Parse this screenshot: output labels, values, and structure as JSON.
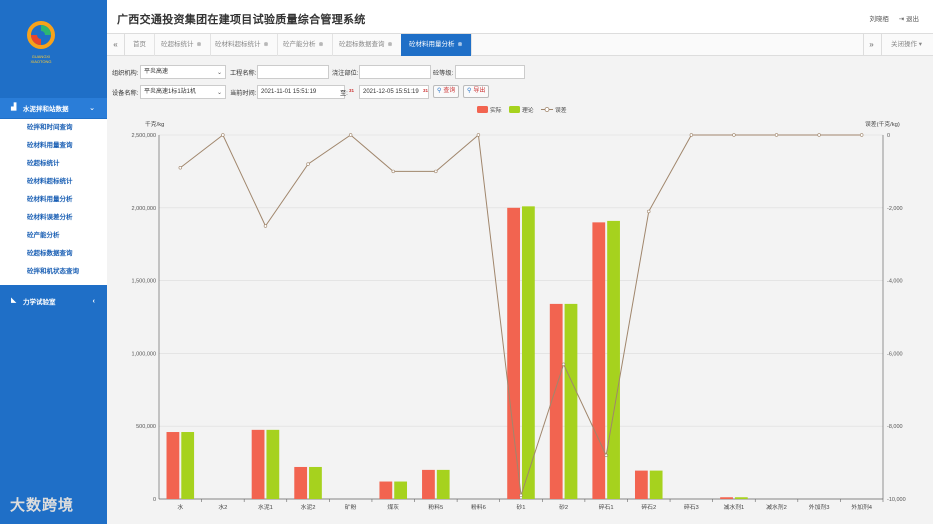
{
  "app": {
    "title": "广西交通投资集团在建项目试验质量综合管理系统",
    "user": "刘晓栢",
    "logout": "退出",
    "logo_text": "GUANGXI XIAOTONG"
  },
  "sidebar": {
    "groups": [
      {
        "label": "水泥拌和站数据",
        "icon": "bar-chart-icon",
        "arrow": "⌄"
      },
      {
        "label": "力学试验室",
        "icon": "rss-icon",
        "arrow": "‹"
      }
    ],
    "items": [
      {
        "label": "砼拌和时间查询"
      },
      {
        "label": "砼材料用量查询"
      },
      {
        "label": "砼超标统计"
      },
      {
        "label": "砼材料超标统计"
      },
      {
        "label": "砼材料用量分析"
      },
      {
        "label": "砼材料误差分析"
      },
      {
        "label": "砼产能分析"
      },
      {
        "label": "砼超标数据查询"
      },
      {
        "label": "砼拌和机状态查询"
      }
    ]
  },
  "tabs": {
    "items": [
      {
        "label": "首页",
        "closable": false
      },
      {
        "label": "砼超标统计",
        "closable": true
      },
      {
        "label": "砼材料超标统计",
        "closable": true
      },
      {
        "label": "砼产能分析",
        "closable": true
      },
      {
        "label": "砼超标数据查询",
        "closable": true
      },
      {
        "label": "砼材料用量分析",
        "closable": true,
        "active": true
      }
    ],
    "close_ops": "关闭操作"
  },
  "filters": {
    "org_label": "组织机构:",
    "org_value": "平炎高速",
    "project_label": "工程名称:",
    "project_value": "",
    "pour_label": "浇注部位:",
    "pour_value": "",
    "grade_label": "砼等级:",
    "grade_value": "",
    "device_label": "设备名称:",
    "device_value": "平炎高速1标1站1机",
    "start_label": "当前时间:",
    "start_value": "2021-11-01 15:51:19",
    "end_label": "至:",
    "end_value": "2021-12-05 15:51:19",
    "cal_label": "31",
    "query_btn": "查询",
    "export_btn": "导出"
  },
  "colors": {
    "actual": "#f26450",
    "theory": "#a6d21e",
    "error": "#a0866c",
    "brand": "#1f6fc7"
  },
  "chart_data": {
    "type": "bar",
    "ylabel": "千克/kg",
    "y2label": "误差(千克/kg)",
    "ylim": [
      0,
      2500000
    ],
    "y2lim": [
      -10000,
      0
    ],
    "yticks": [
      "0",
      "500,000",
      "1,000,000",
      "1,500,000",
      "2,000,000",
      "2,500,000"
    ],
    "y2ticks": [
      "-10,000",
      "-8,000",
      "-6,000",
      "-4,000",
      "-2,000",
      "0"
    ],
    "grid": true,
    "legend": "top-center",
    "categories": [
      "水",
      "水2",
      "水泥1",
      "水泥2",
      "矿粉",
      "煤灰",
      "粉料5",
      "粉料6",
      "砂1",
      "砂2",
      "碎石1",
      "碎石2",
      "碎石3",
      "减水剂1",
      "减水剂2",
      "外加剂3",
      "外加剂4"
    ],
    "series": [
      {
        "name": "实际",
        "kind": "bar",
        "values": [
          460000,
          0,
          475000,
          220000,
          0,
          120000,
          200000,
          0,
          2000000,
          1340000,
          1900000,
          195000,
          0,
          12000,
          0,
          0,
          0
        ]
      },
      {
        "name": "理论",
        "kind": "bar",
        "values": [
          460000,
          0,
          475000,
          220000,
          0,
          120000,
          200000,
          0,
          2010000,
          1340000,
          1910000,
          195000,
          0,
          12000,
          0,
          0,
          0
        ]
      },
      {
        "name": "误差",
        "kind": "line",
        "axis": "right",
        "values": [
          -900,
          0,
          -2500,
          -800,
          0,
          -1000,
          -1000,
          0,
          -9900,
          -6300,
          -8800,
          -2100,
          0,
          0,
          0,
          0,
          0
        ]
      }
    ]
  },
  "watermark": "大数跨境"
}
